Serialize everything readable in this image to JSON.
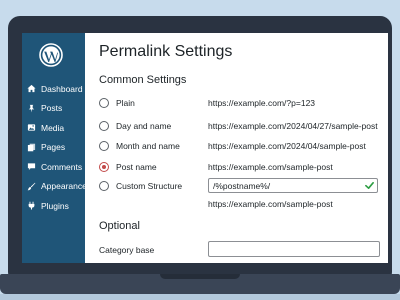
{
  "sidebar": {
    "logo_icon": "wordpress-logo-icon",
    "items": [
      {
        "label": "Dashboard",
        "icon": "dashboard-house-icon"
      },
      {
        "label": "Posts",
        "icon": "pushpin-icon"
      },
      {
        "label": "Media",
        "icon": "media-icon"
      },
      {
        "label": "Pages",
        "icon": "pages-icon"
      },
      {
        "label": "Comments",
        "icon": "comment-bubble-icon"
      },
      {
        "label": "Appearance",
        "icon": "paintbrush-icon"
      },
      {
        "label": "Plugins",
        "icon": "plug-icon"
      }
    ]
  },
  "main": {
    "title": "Permalink Settings",
    "common_settings_title": "Common Settings",
    "options": [
      {
        "label": "Plain",
        "example": "https://example.com/?p=123",
        "selected": false
      },
      {
        "label": "Day and name",
        "example": "https://example.com/2024/04/27/sample-post",
        "selected": false
      },
      {
        "label": "Month and name",
        "example": "https://example.com/2024/04/sample-post",
        "selected": false
      },
      {
        "label": "Post name",
        "example": "https://example.com/sample-post",
        "selected": true
      },
      {
        "label": "Custom Structure",
        "selected": false
      }
    ],
    "custom_structure": {
      "value": "/%postname%/",
      "preview": "https://example.com/sample-post",
      "valid_icon": "checkmark-icon"
    },
    "optional_title": "Optional",
    "category_base_label": "Category base",
    "category_base_value": ""
  },
  "colors": {
    "background": "#c7dbec",
    "laptop_frame": "#2a3341",
    "sidebar_bg": "#1f5578",
    "selected_radio": "#c24a4a",
    "check_green": "#2e9e44"
  }
}
